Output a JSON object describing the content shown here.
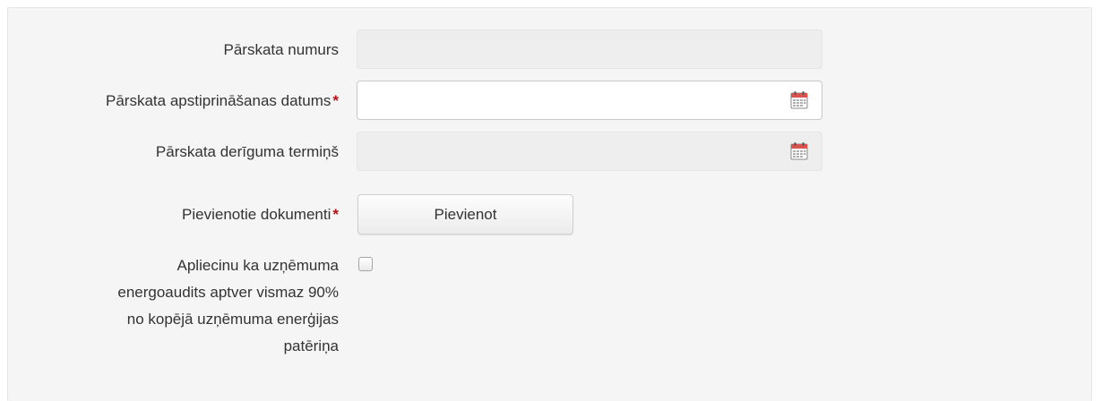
{
  "form": {
    "report_number": {
      "label": "Pārskata numurs",
      "value": ""
    },
    "approval_date": {
      "label": "Pārskata apstiprināšanas datums",
      "required_mark": "*",
      "value": ""
    },
    "validity_date": {
      "label": "Pārskata derīguma termiņš",
      "value": ""
    },
    "documents": {
      "label": "Pievienotie dokumenti",
      "required_mark": "*",
      "button_label": "Pievienot"
    },
    "confirmation": {
      "label": "Apliecinu ka uzņēmuma energoaudits aptver vismaz 90% no kopējā uzņēmuma enerģijas patēriņa",
      "checked": false
    }
  },
  "icons": {
    "calendar": "calendar-icon"
  },
  "colors": {
    "required": "#b40f14",
    "panel_background": "#f5f5f5",
    "disabled_field": "#eeeeee"
  }
}
